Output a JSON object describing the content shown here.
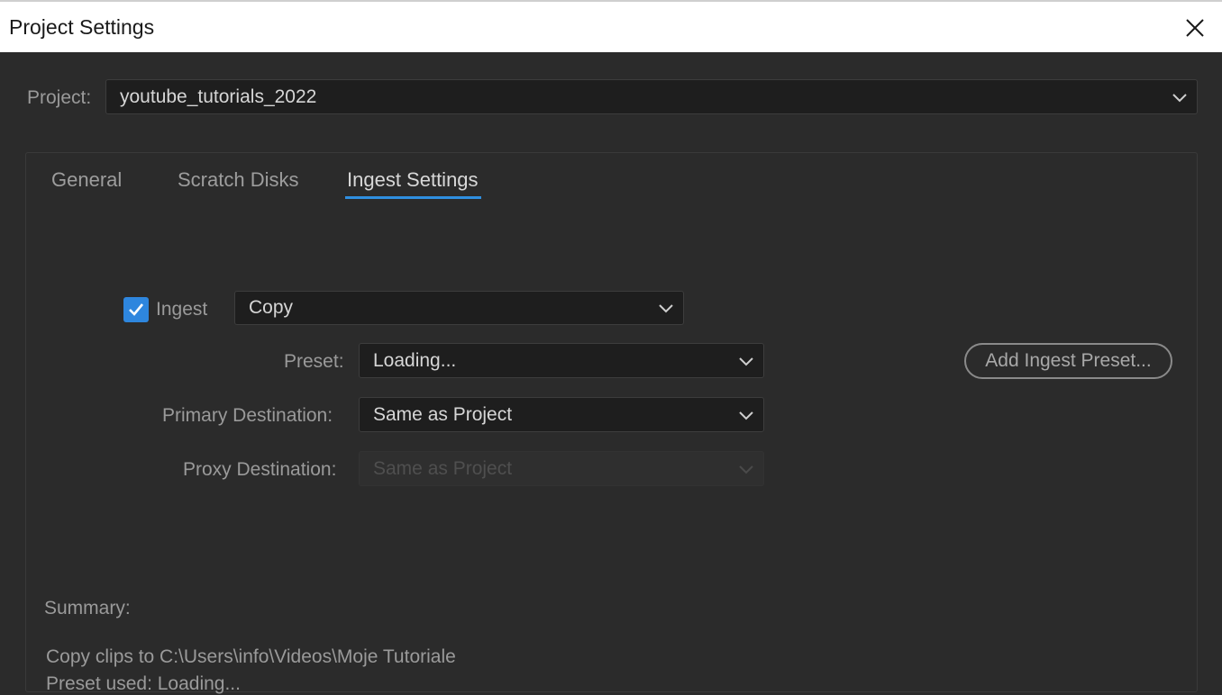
{
  "window": {
    "title": "Project Settings",
    "close_icon": "close-icon"
  },
  "project": {
    "label": "Project:",
    "value": "youtube_tutorials_2022"
  },
  "tabs": [
    {
      "label": "General",
      "active": false
    },
    {
      "label": "Scratch Disks",
      "active": false
    },
    {
      "label": "Ingest Settings",
      "active": true
    }
  ],
  "ingest": {
    "checkbox_label": "Ingest",
    "checked": true,
    "mode_value": "Copy",
    "preset_label": "Preset:",
    "preset_value": "Loading...",
    "add_preset_button": "Add Ingest Preset...",
    "primary_label": "Primary Destination:",
    "primary_value": "Same as Project",
    "proxy_label": "Proxy Destination:",
    "proxy_value": "Same as Project",
    "proxy_disabled": true
  },
  "summary": {
    "title": "Summary:",
    "line1": "Copy clips to C:\\Users\\info\\Videos\\Moje Tutoriale",
    "line2": "Preset used: Loading..."
  },
  "colors": {
    "accent": "#2e86de",
    "background": "#2b2b2b",
    "field": "#1e1e1e"
  }
}
